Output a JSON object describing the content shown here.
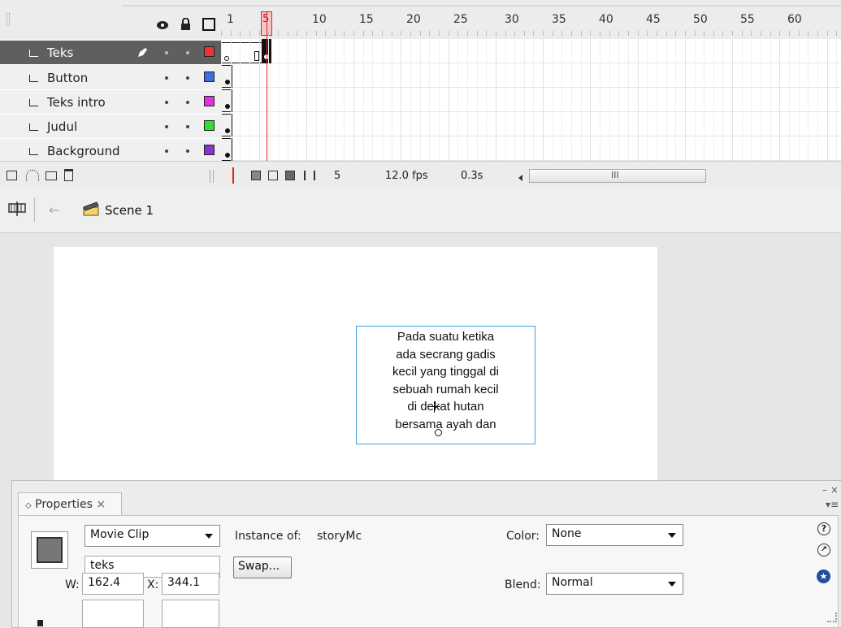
{
  "timeline": {
    "ruler": [
      "1",
      "5",
      "10",
      "15",
      "20",
      "25",
      "30",
      "35",
      "40",
      "45",
      "50",
      "55",
      "60"
    ],
    "layers": [
      {
        "name": "Teks",
        "color": "#ee3333",
        "active": true
      },
      {
        "name": "Button",
        "color": "#3b6fe0",
        "active": false
      },
      {
        "name": "Teks intro",
        "color": "#e030e0",
        "active": false
      },
      {
        "name": "Judul",
        "color": "#33dd33",
        "active": false
      },
      {
        "name": "Background",
        "color": "#8a33c8",
        "active": false
      }
    ],
    "current_frame": "5",
    "fps": "12.0 fps",
    "elapsed": "0.3s",
    "scroll_glyph": "III"
  },
  "editbar": {
    "scene": "Scene 1"
  },
  "stage": {
    "text_lines": [
      "Pada suatu ketika",
      "ada secrang gadis",
      "kecil yang tinggal di",
      "sebuah rumah kecil",
      "di dekat hutan",
      "bersama ayah dan"
    ]
  },
  "properties": {
    "tab_label": "Properties",
    "symbol_type": "Movie Clip",
    "instance_label": "Instance of:",
    "instance_of": "storyMc",
    "instance_name": "teks",
    "swap_label": "Swap...",
    "color_label": "Color:",
    "color_value": "None",
    "blend_label": "Blend:",
    "blend_value": "Normal",
    "w_label": "W:",
    "w_value": "162.4",
    "x_label": "X:",
    "x_value": "344.1"
  },
  "colors": {
    "playhead": "#e52121",
    "stage_selection": "#3ea0e0",
    "active_layer": "#5f5f5f"
  }
}
